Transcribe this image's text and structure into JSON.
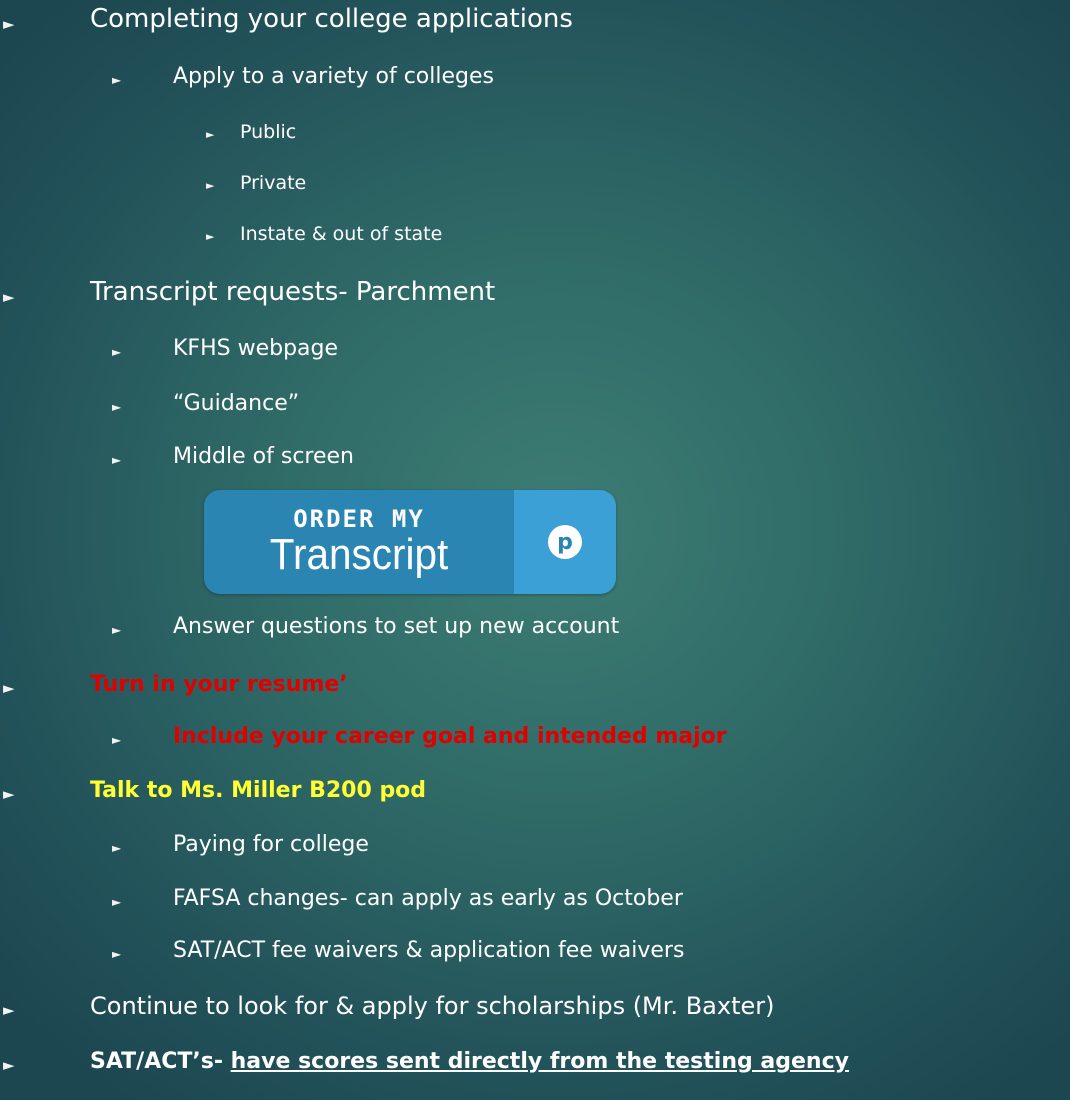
{
  "bullet_glyph": "►",
  "items": [
    {
      "level": 1,
      "text": "Completing your college applications"
    },
    {
      "level": 2,
      "text": "Apply to a variety of colleges"
    },
    {
      "level": 3,
      "text": "Public"
    },
    {
      "level": 3,
      "text": "Private"
    },
    {
      "level": 3,
      "text": "Instate & out of state"
    },
    {
      "level": 1,
      "text": "Transcript requests- Parchment"
    },
    {
      "level": 2,
      "text": "KFHS webpage"
    },
    {
      "level": 2,
      "text": "“Guidance”"
    },
    {
      "level": 2,
      "text": "Middle of screen"
    },
    {
      "level": 2,
      "text": "Answer questions to set up new account"
    },
    {
      "level": 1,
      "text": "Turn in your resume’",
      "color": "#e00000"
    },
    {
      "level": 2,
      "text": "Include your career goal and intended major",
      "color": "#e00000"
    },
    {
      "level": 1,
      "text": "Talk to Ms. Miller B200 pod",
      "color": "#ffff33"
    },
    {
      "level": 2,
      "text": "Paying for college"
    },
    {
      "level": 2,
      "text": "FAFSA changes- can apply as early as October"
    },
    {
      "level": 2,
      "text": "SAT/ACT fee waivers & application fee waivers"
    },
    {
      "level": 1,
      "text": "Continue to look for & apply for scholarships (Mr. Baxter)"
    },
    {
      "level": 1,
      "text_bold": "SAT/ACT’s-",
      "text_underlined": "have scores sent directly from the testing agency"
    }
  ],
  "transcript_button": {
    "line1": "ORDER MY",
    "line2": "Transcript",
    "logo_letter": "p",
    "colors": {
      "left": "#2a85b3",
      "right": "#3aa0d6"
    }
  }
}
